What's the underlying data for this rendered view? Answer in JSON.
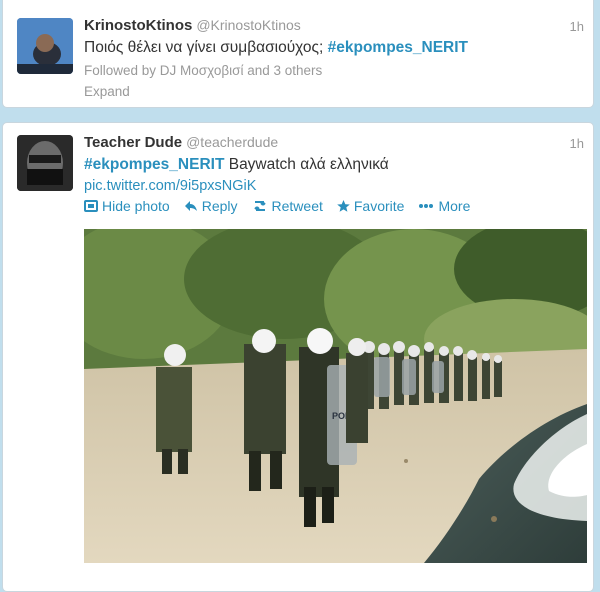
{
  "tweets": [
    {
      "name": "KrinostoKtinos",
      "handle": "@KrinostoKtinos",
      "time": "1h",
      "text": "Ποιός θέλει να γίνει συμβασιούχος; ",
      "hashtag": "#ekpompes_NERIT",
      "followed_by": "Followed by DJ Μοσχοβισί and 3 others",
      "expand": "Expand"
    },
    {
      "name": "Teacher Dude",
      "handle": "@teacherdude",
      "time": "1h",
      "hashtag": "#ekpompes_NERIT",
      "text": " Baywatch αλά ελληνικά",
      "link": "pic.twitter.com/9i5pxsNGiK",
      "actions": {
        "hide_photo": "Hide photo",
        "reply": "Reply",
        "retweet": "Retweet",
        "favorite": "Favorite",
        "more": "More"
      },
      "photo_badge": "POLICE"
    }
  ],
  "colors": {
    "background": "#c0deed",
    "link": "#2a8fbd",
    "name": "#333333",
    "muted": "#999999"
  },
  "icons": [
    "photo-icon",
    "reply-icon",
    "retweet-icon",
    "star-icon",
    "more-dots-icon"
  ]
}
